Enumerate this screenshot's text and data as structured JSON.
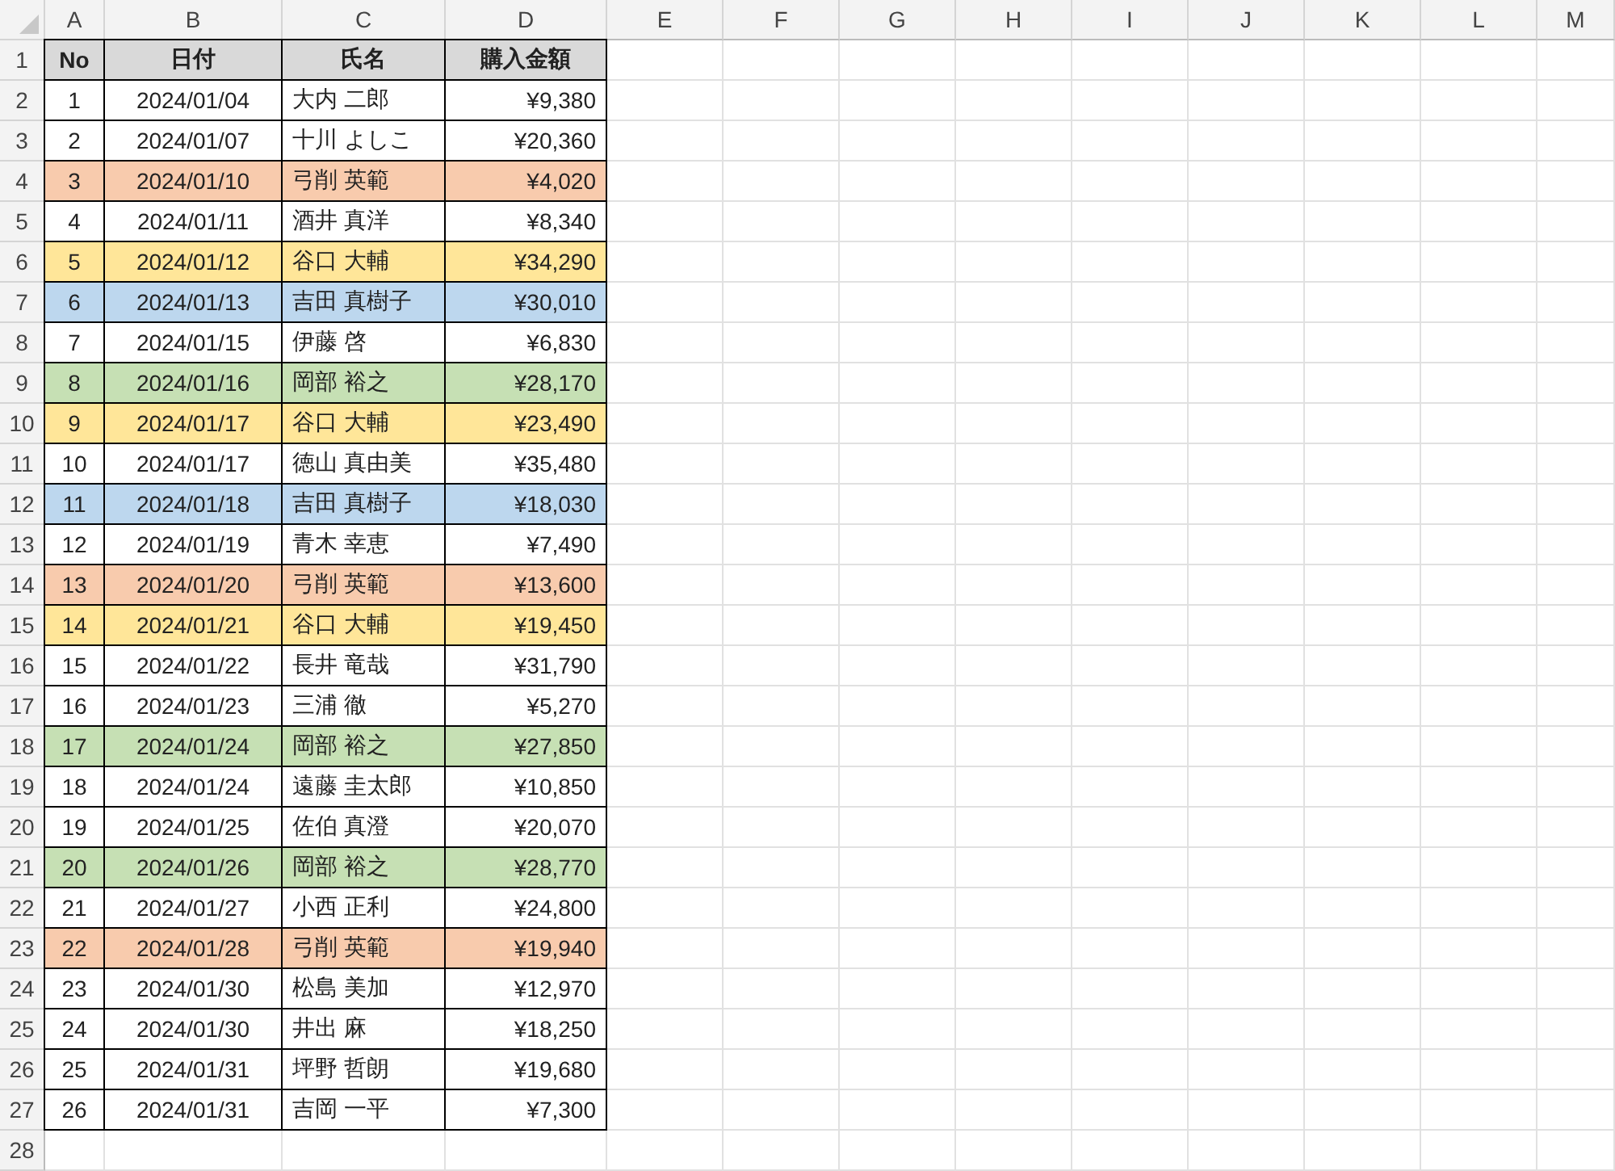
{
  "sheet": {
    "columns": [
      "A",
      "B",
      "C",
      "D",
      "E",
      "F",
      "G",
      "H",
      "I",
      "J",
      "K",
      "L",
      "M"
    ],
    "row_numbers": [
      "1",
      "2",
      "3",
      "4",
      "5",
      "6",
      "7",
      "8",
      "9",
      "10",
      "11",
      "12",
      "13",
      "14",
      "15",
      "16",
      "17",
      "18",
      "19",
      "20",
      "21",
      "22",
      "23",
      "24",
      "25",
      "26",
      "27",
      "28"
    ],
    "table": {
      "header": [
        "No",
        "日付",
        "氏名",
        "購入金額"
      ],
      "rows": [
        {
          "no": "1",
          "date": "2024/01/04",
          "name": "大内 二郎",
          "amount": "¥9,380"
        },
        {
          "no": "2",
          "date": "2024/01/07",
          "name": "十川 よしこ",
          "amount": "¥20,360"
        },
        {
          "no": "3",
          "date": "2024/01/10",
          "name": "弓削 英範",
          "amount": "¥4,020",
          "color": "#f8cbad"
        },
        {
          "no": "4",
          "date": "2024/01/11",
          "name": "酒井 真洋",
          "amount": "¥8,340"
        },
        {
          "no": "5",
          "date": "2024/01/12",
          "name": "谷口 大輔",
          "amount": "¥34,290",
          "color": "#ffe699"
        },
        {
          "no": "6",
          "date": "2024/01/13",
          "name": "吉田 真樹子",
          "amount": "¥30,010",
          "color": "#bdd7ee"
        },
        {
          "no": "7",
          "date": "2024/01/15",
          "name": "伊藤 啓",
          "amount": "¥6,830"
        },
        {
          "no": "8",
          "date": "2024/01/16",
          "name": "岡部 裕之",
          "amount": "¥28,170",
          "color": "#c6e0b4"
        },
        {
          "no": "9",
          "date": "2024/01/17",
          "name": "谷口 大輔",
          "amount": "¥23,490",
          "color": "#ffe699"
        },
        {
          "no": "10",
          "date": "2024/01/17",
          "name": "徳山 真由美",
          "amount": "¥35,480"
        },
        {
          "no": "11",
          "date": "2024/01/18",
          "name": "吉田 真樹子",
          "amount": "¥18,030",
          "color": "#bdd7ee"
        },
        {
          "no": "12",
          "date": "2024/01/19",
          "name": "青木 幸恵",
          "amount": "¥7,490"
        },
        {
          "no": "13",
          "date": "2024/01/20",
          "name": "弓削 英範",
          "amount": "¥13,600",
          "color": "#f8cbad"
        },
        {
          "no": "14",
          "date": "2024/01/21",
          "name": "谷口 大輔",
          "amount": "¥19,450",
          "color": "#ffe699"
        },
        {
          "no": "15",
          "date": "2024/01/22",
          "name": "長井 竜哉",
          "amount": "¥31,790"
        },
        {
          "no": "16",
          "date": "2024/01/23",
          "name": "三浦 徹",
          "amount": "¥5,270"
        },
        {
          "no": "17",
          "date": "2024/01/24",
          "name": "岡部 裕之",
          "amount": "¥27,850",
          "color": "#c6e0b4"
        },
        {
          "no": "18",
          "date": "2024/01/24",
          "name": "遠藤 圭太郎",
          "amount": "¥10,850"
        },
        {
          "no": "19",
          "date": "2024/01/25",
          "name": "佐伯 真澄",
          "amount": "¥20,070"
        },
        {
          "no": "20",
          "date": "2024/01/26",
          "name": "岡部 裕之",
          "amount": "¥28,770",
          "color": "#c6e0b4"
        },
        {
          "no": "21",
          "date": "2024/01/27",
          "name": "小西 正利",
          "amount": "¥24,800"
        },
        {
          "no": "22",
          "date": "2024/01/28",
          "name": "弓削 英範",
          "amount": "¥19,940",
          "color": "#f8cbad"
        },
        {
          "no": "23",
          "date": "2024/01/30",
          "name": "松島 美加",
          "amount": "¥12,970"
        },
        {
          "no": "24",
          "date": "2024/01/30",
          "name": "井出 麻",
          "amount": "¥18,250"
        },
        {
          "no": "25",
          "date": "2024/01/31",
          "name": "坪野 哲朗",
          "amount": "¥19,680"
        },
        {
          "no": "26",
          "date": "2024/01/31",
          "name": "吉岡 一平",
          "amount": "¥7,300"
        }
      ]
    }
  }
}
